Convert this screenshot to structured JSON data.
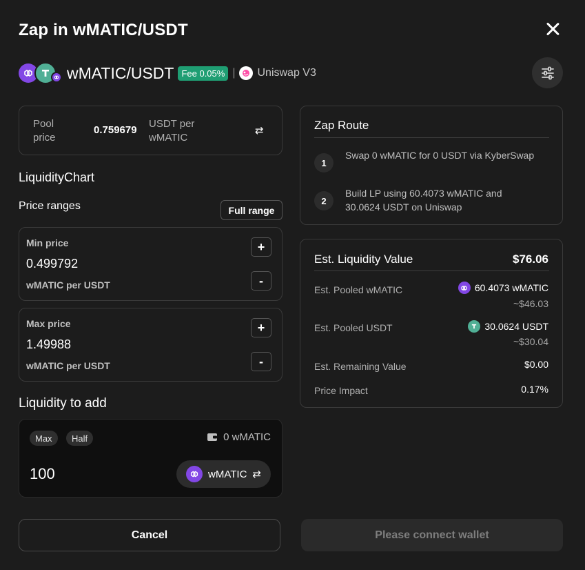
{
  "header": {
    "title": "Zap in wMATIC/USDT"
  },
  "pool": {
    "pair": "wMATIC/USDT",
    "fee": "Fee 0.05%",
    "separator": "|",
    "dex": "Uniswap V3"
  },
  "pool_price": {
    "label": "Pool price",
    "value": "0.759679",
    "unit": "USDT per wMATIC"
  },
  "liquidity_chart": {
    "title": "LiquidityChart"
  },
  "price_ranges": {
    "title": "Price ranges",
    "full_range_label": "Full range",
    "min": {
      "label": "Min price",
      "value": "0.499792",
      "unit": "wMATIC per USDT"
    },
    "max": {
      "label": "Max price",
      "value": "1.49988",
      "unit": "wMATIC per USDT"
    },
    "plus": "+",
    "minus": "-"
  },
  "liquidity_to_add": {
    "title": "Liquidity to add",
    "max_label": "Max",
    "half_label": "Half",
    "balance": "0 wMATIC",
    "amount": "100",
    "token": "wMATIC"
  },
  "zap_route": {
    "title": "Zap Route",
    "steps": [
      {
        "num": "1",
        "text": "Swap 0 wMATIC for 0 USDT via KyberSwap"
      },
      {
        "num": "2",
        "text": "Build LP using 60.4073 wMATIC and 30.0624 USDT on Uniswap"
      }
    ]
  },
  "estimate": {
    "title": "Est. Liquidity Value",
    "total": "$76.06",
    "pooled_wmatic": {
      "label": "Est. Pooled wMATIC",
      "value": "60.4073 wMATIC",
      "usd": "~$46.03"
    },
    "pooled_usdt": {
      "label": "Est. Pooled USDT",
      "value": "30.0624 USDT",
      "usd": "~$30.04"
    },
    "remaining": {
      "label": "Est. Remaining Value",
      "value": "$0.00"
    },
    "impact": {
      "label": "Price Impact",
      "value": "0.17%"
    }
  },
  "footer": {
    "cancel": "Cancel",
    "connect": "Please connect wallet"
  },
  "colors": {
    "background": "#1c1c1c",
    "accent": "#1f9e73",
    "matic": "#8247e5",
    "tether": "#50af95"
  }
}
